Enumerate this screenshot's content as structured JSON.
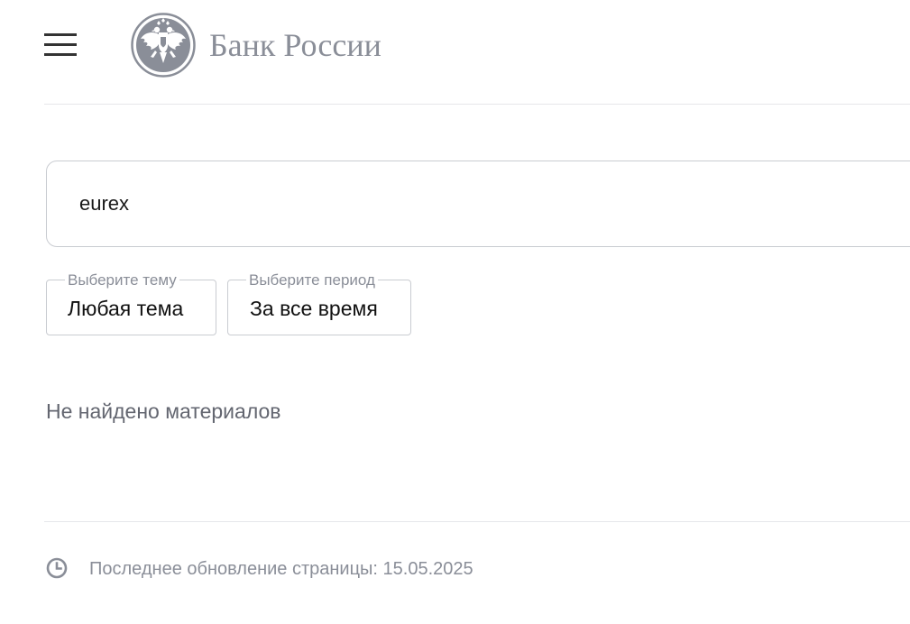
{
  "header": {
    "menu_icon": "hamburger-menu-icon",
    "logo_icon": "double-headed-eagle-emblem-icon",
    "logo_text": "Банк России",
    "logo_color": "#8a8e98"
  },
  "search": {
    "value": "eurex"
  },
  "filters": {
    "theme": {
      "legend": "Выберите тему",
      "value": "Любая тема"
    },
    "period": {
      "legend": "Выберите период",
      "value": "За все время"
    }
  },
  "results": {
    "empty_message": "Не найдено материалов"
  },
  "footer": {
    "clock_icon": "clock-icon",
    "last_update": "Последнее обновление страницы: 15.05.2025"
  }
}
